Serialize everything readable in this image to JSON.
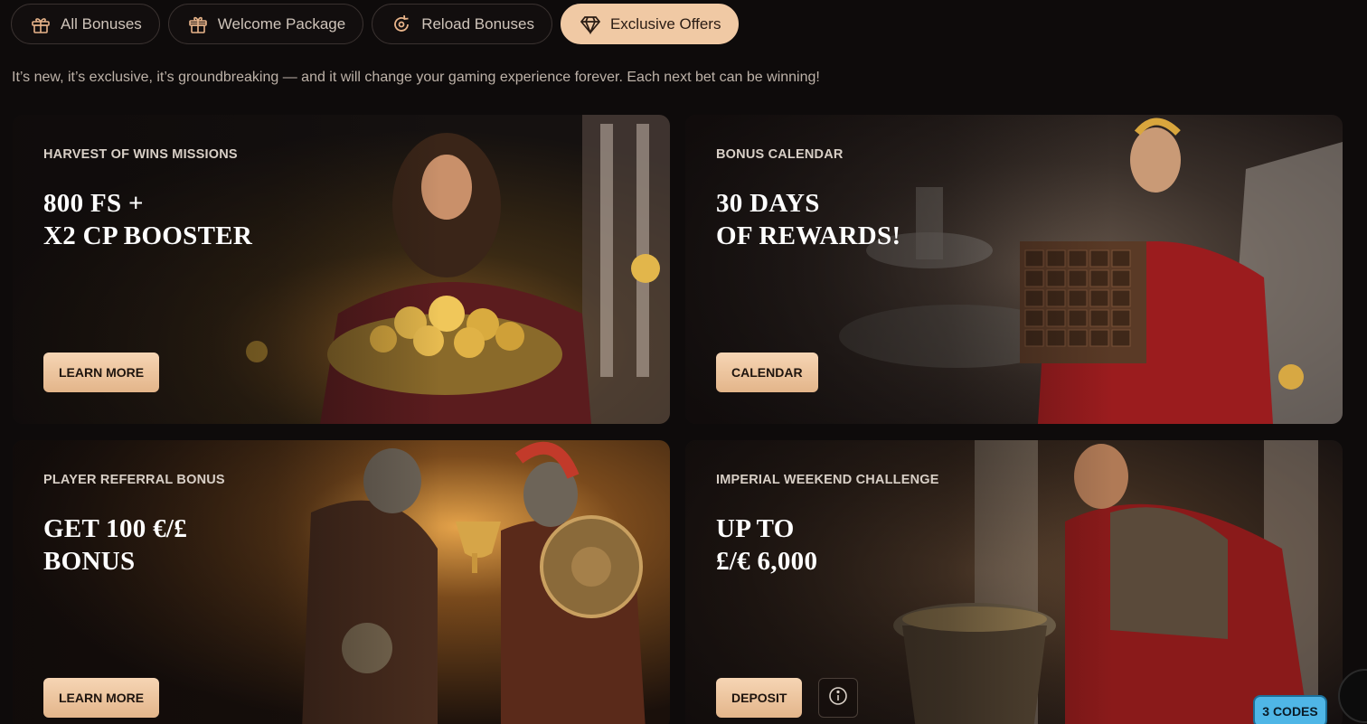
{
  "tabs": [
    {
      "label": "All Bonuses",
      "icon": "gift-icon",
      "active": false
    },
    {
      "label": "Welcome Package",
      "icon": "gift-box-icon",
      "active": false
    },
    {
      "label": "Reload Bonuses",
      "icon": "reload-icon",
      "active": false
    },
    {
      "label": "Exclusive Offers",
      "icon": "diamond-icon",
      "active": true
    }
  ],
  "intro": "It’s new, it’s exclusive, it’s groundbreaking — and it will change your gaming experience forever. Each next bet can be winning!",
  "cards": [
    {
      "label": "HARVEST OF WINS MISSIONS",
      "headline": "800 FS +\nX2 CP BOOSTER",
      "cta": "LEARN MORE"
    },
    {
      "label": "BONUS CALENDAR",
      "headline": "30 DAYS\nOF REWARDS!",
      "cta": "CALENDAR"
    },
    {
      "label": "PLAYER REFERRAL BONUS",
      "headline": "GET 100 €/£\nBONUS",
      "cta": "LEARN MORE"
    },
    {
      "label": "IMPERIAL WEEKEND CHALLENGE",
      "headline": "UP TO\n£/€ 6,000",
      "cta": "DEPOSIT"
    }
  ],
  "codes_badge": "3 CODES",
  "colors": {
    "accent": "#f0c9a4",
    "background": "#0e0b0b",
    "badge": "#4fb6e6"
  }
}
